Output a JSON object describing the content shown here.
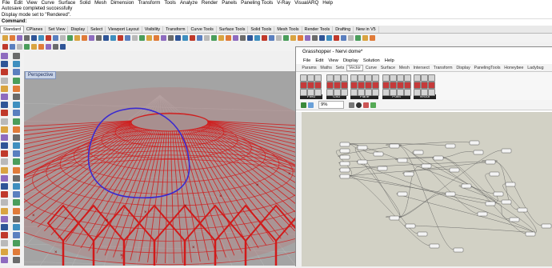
{
  "menu": [
    "File",
    "Edit",
    "View",
    "Curve",
    "Surface",
    "Solid",
    "Mesh",
    "Dimension",
    "Transform",
    "Tools",
    "Analyze",
    "Render",
    "Panels",
    "Paneling Tools",
    "V-Ray",
    "VisualARQ",
    "Help"
  ],
  "command_history": [
    "Autosave completed successfully",
    "Display mode set to \"Rendered\"."
  ],
  "command_prompt": "Command:",
  "toolbar_tabs": [
    "Standard",
    "CPlanes",
    "Set View",
    "Display",
    "Select",
    "Viewport Layout",
    "Visibility",
    "Transform",
    "Curve Tools",
    "Surface Tools",
    "Solid Tools",
    "Mesh Tools",
    "Render Tools",
    "Drafting",
    "New in V5"
  ],
  "viewport": {
    "label": "Perspective"
  },
  "grasshopper": {
    "title": "Grasshopper - Nervi dome*",
    "menu": [
      "File",
      "Edit",
      "View",
      "Display",
      "Solution",
      "Help"
    ],
    "tabs": [
      "Params",
      "Maths",
      "Sets",
      "Vector",
      "Curve",
      "Surface",
      "Mesh",
      "Intersect",
      "Transform",
      "Display",
      "PanelingTools",
      "Honeybee",
      "Ladybug"
    ],
    "active_tab": "Vector",
    "groups": [
      "Field",
      "Grid",
      "Plane",
      "Point",
      "Vector"
    ],
    "zoom": "9%"
  },
  "colors": {
    "accent": "#d11a1a",
    "curve": "#3a2ad0",
    "canvas": "#d2d1c5"
  }
}
